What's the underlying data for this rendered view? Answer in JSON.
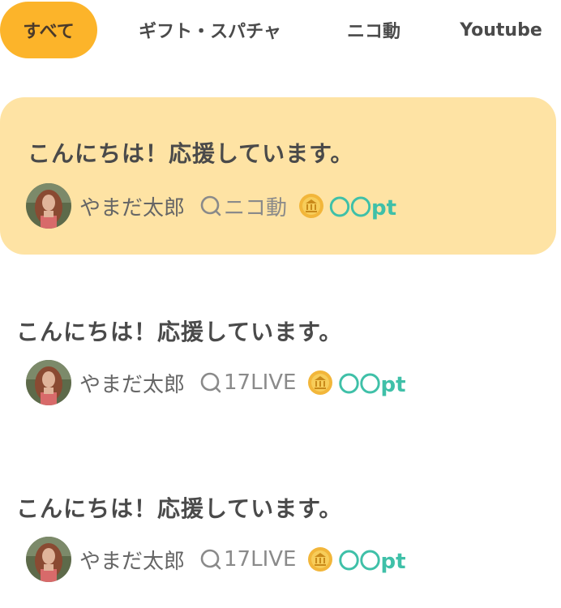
{
  "tabs": [
    {
      "label": "すべて",
      "active": true
    },
    {
      "label": "ギフト・スパチャ",
      "active": false
    },
    {
      "label": "ニコ動",
      "active": false
    },
    {
      "label": "Youtube",
      "active": false
    }
  ],
  "colors": {
    "accent": "#fcb42a",
    "highlight_bg": "#fee3a4",
    "points": "#3fc0a8",
    "text": "#4a4a4a"
  },
  "cards": [
    {
      "message": "こんにちは！応援しています。",
      "user": "やまだ太郎",
      "platform": "ニコ動",
      "points": "〇〇pt",
      "highlighted": true,
      "platform_icon": "search-icon",
      "coin_icon": "coin-icon"
    },
    {
      "message": "こんにちは！応援しています。",
      "user": "やまだ太郎",
      "platform": "17LIVE",
      "points": "〇〇pt",
      "highlighted": false,
      "platform_icon": "search-icon",
      "coin_icon": "coin-icon"
    },
    {
      "message": "こんにちは！応援しています。",
      "user": "やまだ太郎",
      "platform": "17LIVE",
      "points": "〇〇pt",
      "highlighted": false,
      "platform_icon": "search-icon",
      "coin_icon": "coin-icon"
    }
  ]
}
